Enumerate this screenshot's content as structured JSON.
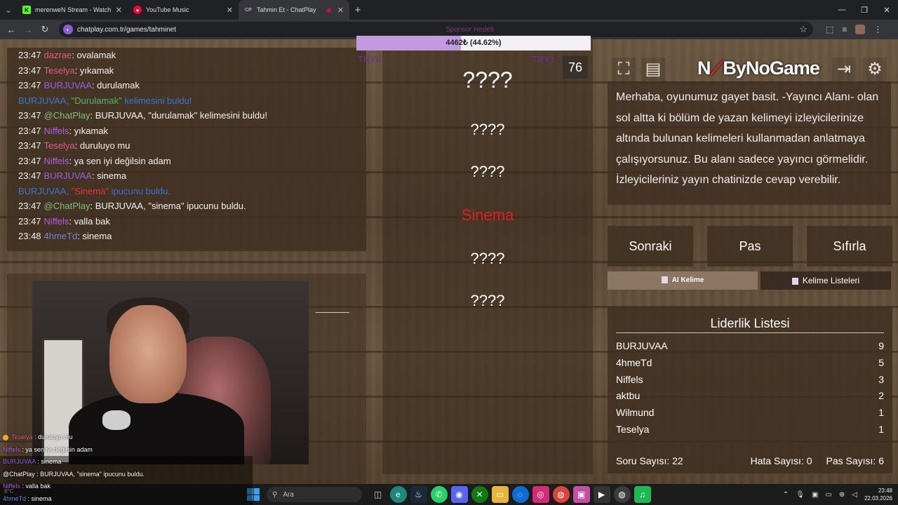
{
  "browser": {
    "tabs": [
      {
        "title": "merenweN Stream - Watch Live",
        "icon": "kick-icon",
        "color": "#53fc18",
        "glyph": "K"
      },
      {
        "title": "YouTube Music",
        "icon": "youtube-music-icon",
        "color": "#ff0033",
        "glyph": "●"
      },
      {
        "title": "Tahmin Et - ChatPlay",
        "icon": "chatplay-icon",
        "color": "#6d3fa8",
        "glyph": "CP"
      }
    ],
    "url": "chatplay.com.tr/games/tahminet"
  },
  "chat": {
    "messages": [
      {
        "time": "23:47",
        "user": "dazrae",
        "color": "#e35a8a",
        "text": ": ovalamak",
        "system": false
      },
      {
        "time": "23:47",
        "user": "Teselya",
        "color": "#e35a8a",
        "text": ": yıkamak",
        "system": false
      },
      {
        "time": "23:47",
        "user": "BURJUVAA",
        "color": "#9b5de5",
        "text": ": durulamak",
        "system": false
      },
      {
        "time": "",
        "user": "",
        "color": "",
        "text": "",
        "system": true,
        "pre": "BURJUVAA, ",
        "word": "\"Durulamak\"",
        "wordColor": "#57b36b",
        "post": " kelimesini buldu!"
      },
      {
        "time": "23:47",
        "user": "@ChatPlay",
        "color": "#7ec07e",
        "text": ": BURJUVAA, \"durulamak\" kelimesini buldu!",
        "system": false
      },
      {
        "time": "23:47",
        "user": "Niffels",
        "color": "#b35ee8",
        "text": ": yıkamak",
        "system": false
      },
      {
        "time": "23:47",
        "user": "Teselya",
        "color": "#e35a8a",
        "text": ": duruluyo mu",
        "system": false
      },
      {
        "time": "23:47",
        "user": "Niffels",
        "color": "#b35ee8",
        "text": ": ya sen iyi değilsin adam",
        "system": false
      },
      {
        "time": "23:47",
        "user": "BURJUVAA",
        "color": "#9b5de5",
        "text": ": sinema",
        "system": false
      },
      {
        "time": "",
        "user": "",
        "color": "",
        "text": "",
        "system": true,
        "pre": "BURJUVAA, ",
        "word": "\"Sinema\"",
        "wordColor": "#e83535",
        "post": " ipucunu buldu."
      },
      {
        "time": "23:47",
        "user": "@ChatPlay",
        "color": "#7ec07e",
        "text": ": BURJUVAA, \"sinema\" ipucunu buldu.",
        "system": false
      },
      {
        "time": "23:47",
        "user": "Niffels",
        "color": "#b35ee8",
        "text": ": valla bak",
        "system": false
      },
      {
        "time": "23:48",
        "user": "4hmeTd",
        "color": "#6a88d8",
        "text": ": sinema",
        "system": false
      }
    ]
  },
  "overlay_chat": [
    {
      "user": "Teselya",
      "color": "#e35a8a",
      "text": " : duruluyo mu",
      "badge": true
    },
    {
      "user": "Niffels",
      "color": "#b35ee8",
      "text": " : ya sen iyi değilsin adam",
      "badge": false
    },
    {
      "user": "BURJUVAA",
      "color": "#9b5de5",
      "text": " : sinema",
      "badge": false
    },
    {
      "user": "@ChatPlay",
      "color": "#ffffff",
      "text": " : BURJUVAA, \"sinema\" ipucunu buldu.",
      "badge": false
    },
    {
      "user": "Niffels",
      "color": "#b35ee8",
      "text": " : valla bak",
      "badge": false
    },
    {
      "user": "4hmeTd",
      "color": "#6a88d8",
      "text": " : sinema",
      "badge": false
    }
  ],
  "game": {
    "progress_label": "4462₺ (44.62%)",
    "progress_fraction": 0.4462,
    "progress_overlay_text": "Sponsor Hedefi",
    "try_left": "TRY0",
    "try_right": "TRY1",
    "timer": "76",
    "words": [
      {
        "text": "????",
        "state": "hidden",
        "size": "big"
      },
      {
        "text": "????",
        "state": "hidden",
        "size": "mid"
      },
      {
        "text": "????",
        "state": "hidden",
        "size": "mid"
      },
      {
        "text": "Sinema",
        "state": "revealed",
        "size": "mid"
      },
      {
        "text": "????",
        "state": "hidden",
        "size": "mid"
      },
      {
        "text": "????",
        "state": "hidden",
        "size": "mid"
      }
    ]
  },
  "tools": {
    "brand_pre": "N",
    "brand_post": "ByNoGame",
    "brand_ghost": "NoGame?"
  },
  "info_text": "Merhaba, oyunumuz gayet basit. -Yayıncı Alanı- olan sol altta ki bölüm de yazan kelimeyi izleyicilerinize altında bulunan kelimeleri kullanmadan anlatmaya çalışıyorsunuz. Bu alanı sadece yayıncı görmelidir. İzleyicileriniz yayın chatinizde cevap verebilir.",
  "actions": {
    "next": "Sonraki",
    "pass": "Pas",
    "reset": "Sıfırla"
  },
  "source_tabs": {
    "ai": "AI Kelime",
    "lists": "Kelime Listeleri"
  },
  "leaderboard": {
    "title": "Liderlik Listesi",
    "rows": [
      {
        "name": "BURJUVAA",
        "score": "9"
      },
      {
        "name": "4hmeTd",
        "score": "5"
      },
      {
        "name": "Niffels",
        "score": "3"
      },
      {
        "name": "aktbu",
        "score": "2"
      },
      {
        "name": "Wilmund",
        "score": "1"
      },
      {
        "name": "Teselya",
        "score": "1"
      }
    ],
    "question_count": "Soru Sayısı: 22",
    "error_count": "Hata Sayısı: 0",
    "pass_count": "Pas Sayısı: 6"
  },
  "taskbar": {
    "search": "Ara",
    "time": "23:48",
    "date": "22.03.2026",
    "weather": "8°C"
  }
}
